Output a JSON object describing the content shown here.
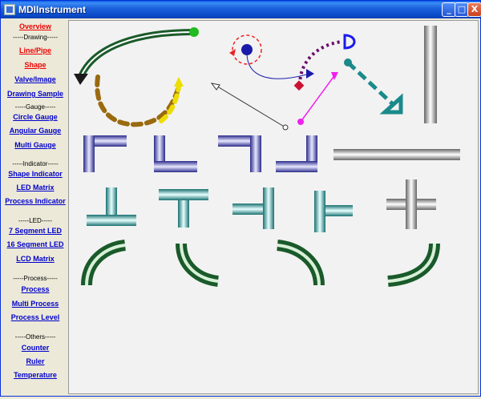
{
  "window": {
    "title": "MDIInstrument",
    "buttons": {
      "minimize": "_",
      "maximize": "□",
      "close": "X"
    }
  },
  "sidebar": {
    "items": [
      {
        "label": "Overview",
        "color": "#ee0000"
      },
      {
        "section": "-----Drawing-----"
      },
      {
        "label": "Line/Pipe",
        "color": "#ee0000"
      },
      {
        "label": "Shape",
        "color": "#ee0000"
      },
      {
        "label": "Valve/Image"
      },
      {
        "label": "Drawing Sample"
      },
      {
        "section": "-----Gauge-----"
      },
      {
        "label": "Circle Gauge"
      },
      {
        "label": "Angular Gauge"
      },
      {
        "label": "Multi Gauge"
      },
      {
        "section": "-----Indicator-----"
      },
      {
        "label": "Shape Indicator"
      },
      {
        "label": "LED Matrix"
      },
      {
        "label": "Process Indicator"
      },
      {
        "section": "-----LED-----"
      },
      {
        "label": "7  Segment LED"
      },
      {
        "label": "16 Segment LED"
      },
      {
        "label": "LCD Matrix"
      },
      {
        "section": "-----Process-----"
      },
      {
        "label": "Process"
      },
      {
        "label": "Multi Process"
      },
      {
        "label": "Process Level"
      },
      {
        "section": "-----Others-----"
      },
      {
        "label": "Counter"
      },
      {
        "label": "Ruler"
      },
      {
        "label": "Temperature"
      }
    ]
  },
  "colors": {
    "link": "#0000cc",
    "active": "#ee0000",
    "pipe_blue": "#3a3aa0",
    "pipe_cyan": "#2a8c8c",
    "pipe_green": "#2a6a3a",
    "pipe_gray": "#8a8a8a"
  }
}
